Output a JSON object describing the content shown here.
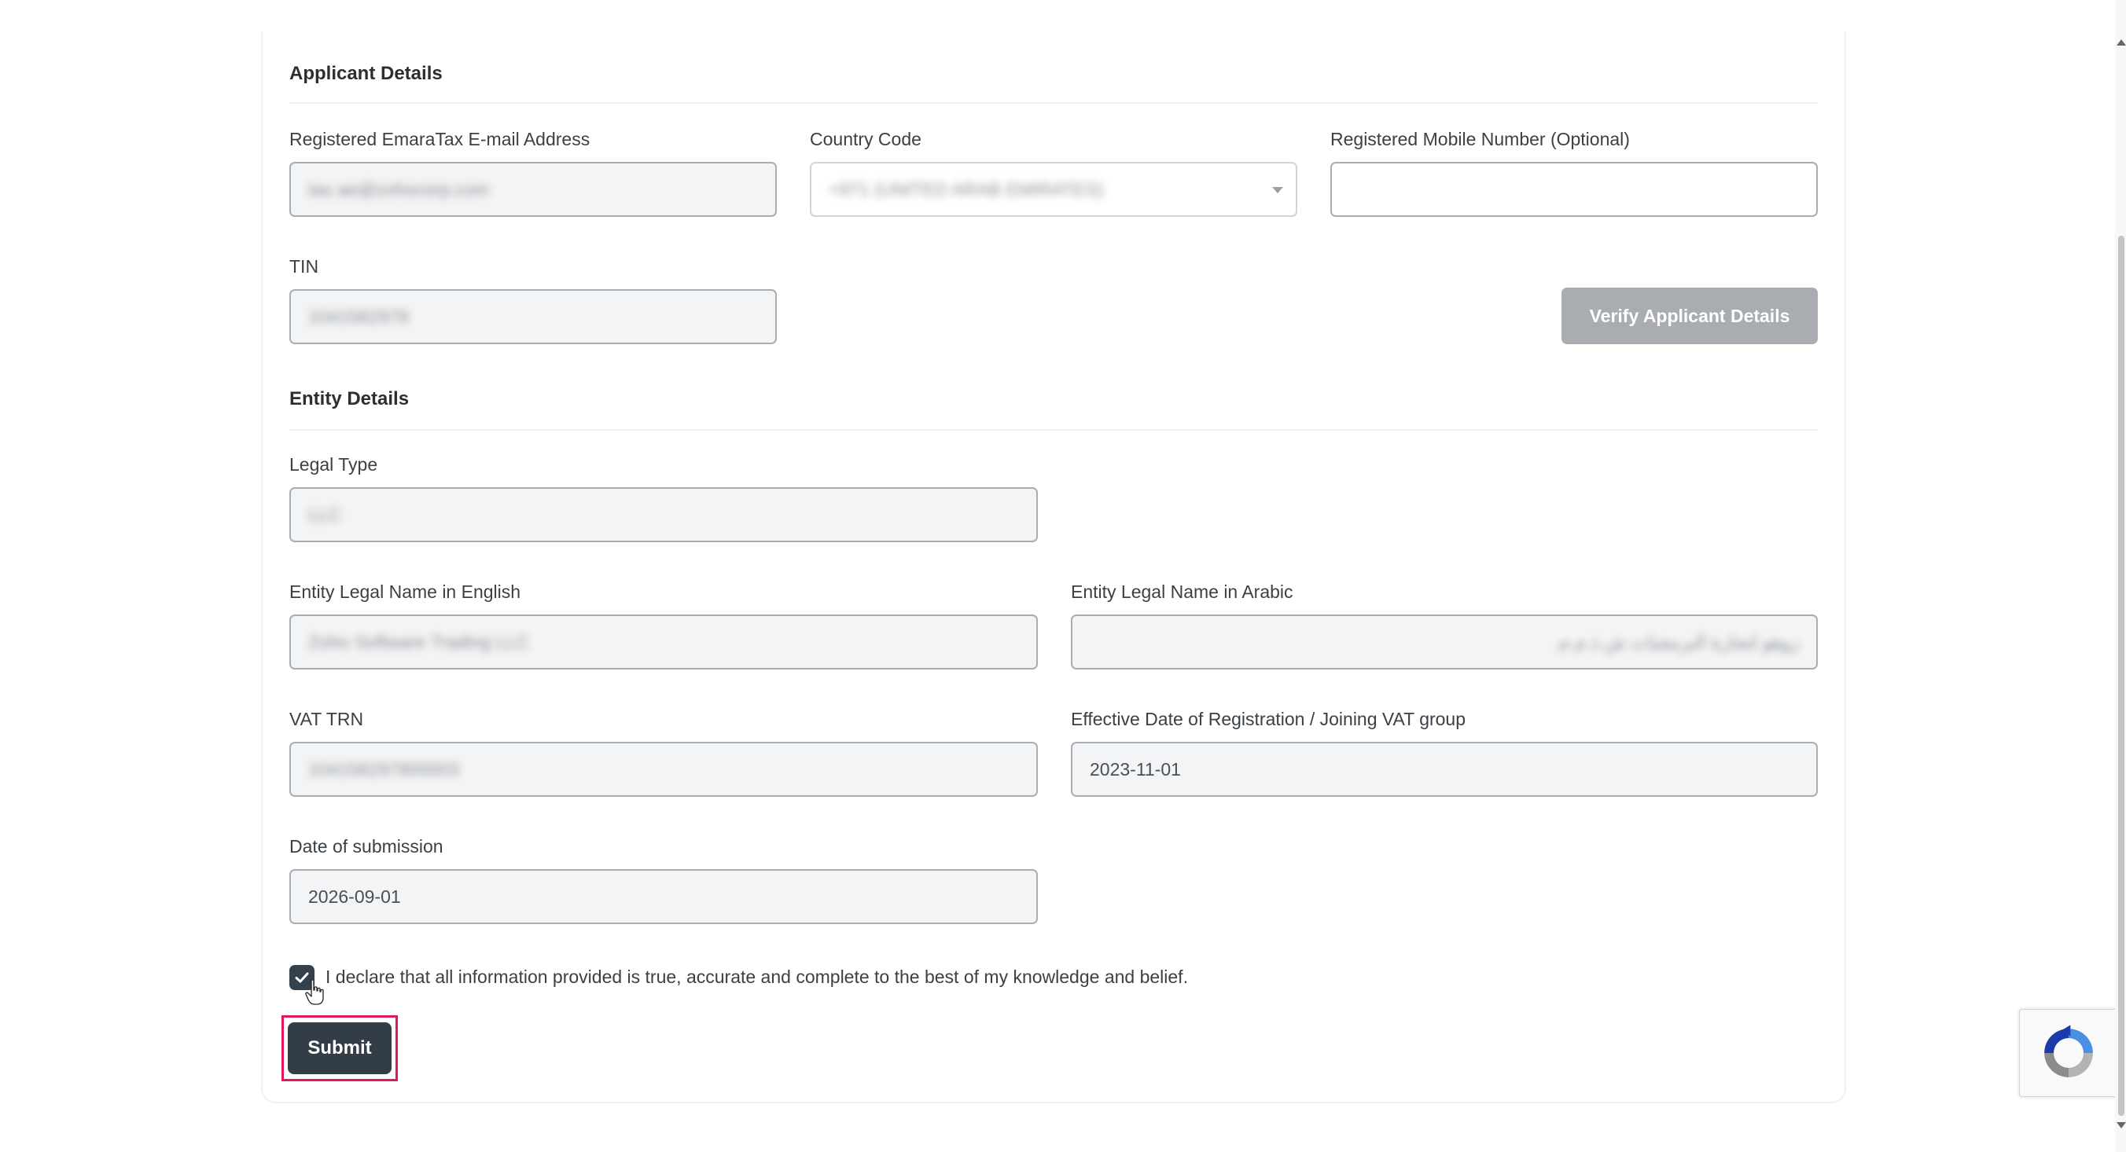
{
  "applicant": {
    "title": "Applicant Details",
    "email_label": "Registered EmaraTax E-mail Address",
    "email_value": "tax.ae@zohocorp.com",
    "country_label": "Country Code",
    "country_value": "+971 (UNITED ARAB EMIRATES)",
    "mobile_label": "Registered Mobile Number (Optional)",
    "mobile_value": "",
    "tin_label": "TIN",
    "tin_value": "1041582978",
    "verify_label": "Verify Applicant Details"
  },
  "entity": {
    "title": "Entity Details",
    "legal_type_label": "Legal Type",
    "legal_type_value": "LLC",
    "name_en_label": "Entity Legal Name in English",
    "name_en_value": "Zoho Software Trading LLC",
    "name_ar_label": "Entity Legal Name in Arabic",
    "name_ar_value": "زوهو لتجارة البرمجيات ش.ذ.م.م",
    "vat_trn_label": "VAT TRN",
    "vat_trn_value": "104158297800003",
    "effective_date_label": "Effective Date of Registration / Joining VAT group",
    "effective_date_value": "2023-11-01",
    "submission_date_label": "Date of submission",
    "submission_date_value": "2026-09-01"
  },
  "declaration": {
    "text": "I declare that all information provided is true, accurate and complete to the best of my knowledge and belief.",
    "checked": true
  },
  "submit_label": "Submit",
  "colors": {
    "primary_button": "#323d48",
    "disabled_button": "#a9adb1",
    "highlight_border": "#e2185a",
    "field_border": "#a8adb2",
    "field_bg": "#f3f4f5"
  },
  "icons": {
    "checkbox": "check-icon",
    "dropdown": "chevron-down-icon",
    "cursor": "hand-pointer-icon",
    "captcha": "recaptcha-icon"
  }
}
